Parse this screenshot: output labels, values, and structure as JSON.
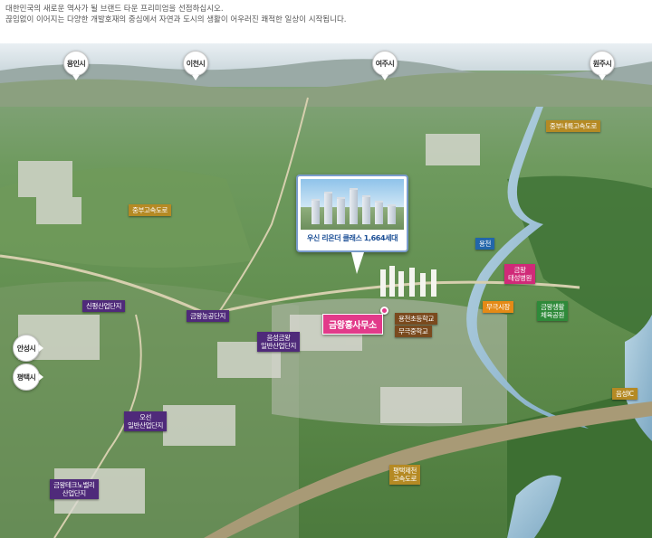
{
  "intro": {
    "line1": "대한민국의 새로운 역사가 될 브랜드 타운 프리미엄을 선점하십시오.",
    "line2": "끊임없이 이어지는 다양한 개발호재의 중심에서 자연과 도시의 생활이 어우러진 쾌적한 일상이 시작됩니다."
  },
  "cities": {
    "yongin": "용인시",
    "icheon": "이천시",
    "yeoju": "여주시",
    "wonju": "원주시",
    "anseong": "안성시",
    "pyeongtaek": "평택시"
  },
  "roads": {
    "jungbu_naeryuk": "중부내륙고속도로",
    "jungbu": "중부고속도로",
    "pyeongtaek_jecheon": [
      "평택제천",
      "고속도로"
    ],
    "eumseong_ic": "음성IC"
  },
  "industrial": {
    "sinpyeong": "신평산업단지",
    "geumwang_agri": "금왕농공단지",
    "eumseong_geumwang": [
      "음성금왕",
      "일반산업단지"
    ],
    "oseon": [
      "오선",
      "일반산업단지"
    ],
    "geumwang_techno": [
      "금왕테크노밸리",
      "산업단지"
    ]
  },
  "schools": {
    "yongcheon_elem": "용천초등학교",
    "mugeuk_middle": "무극중학교"
  },
  "facilities": {
    "yongcheon": "용천",
    "geumwang_hospital": [
      "금왕",
      "태성병원"
    ],
    "mugeuk_market": "무극시장",
    "geumwang_sports": [
      "금왕생활",
      "체육공원"
    ]
  },
  "complex": {
    "caption": "우신 리온더 클래스 1,664세대"
  },
  "sales_office": "금왕홍사무소",
  "colors": {
    "gold": "#b58a24",
    "purple": "#4f2a7a",
    "brown": "#7a4a1e",
    "magenta": "#d02a78",
    "orange": "#e58a16",
    "green": "#2f8a3a",
    "blue": "#2266aa",
    "office": "#e23a8a"
  }
}
